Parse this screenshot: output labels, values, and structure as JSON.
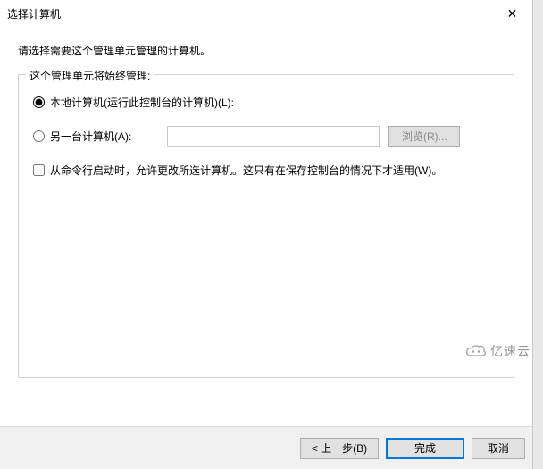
{
  "titlebar": {
    "title": "选择计算机"
  },
  "content": {
    "instruction": "请选择需要这个管理单元管理的计算机。",
    "groupLegend": "这个管理单元将始终管理:",
    "radioLocal": "本地计算机(运行此控制台的计算机)(L):",
    "radioAnother": "另一台计算机(A):",
    "computerValue": "",
    "browseLabel": "浏览(R)...",
    "checkboxLabel": "从命令行启动时，允许更改所选计算机。这只有在保存控制台的情况下才适用(W)。"
  },
  "buttons": {
    "back": "< 上一步(B)",
    "finish": "完成",
    "cancel": "取消"
  },
  "watermark": {
    "text": "亿速云"
  }
}
